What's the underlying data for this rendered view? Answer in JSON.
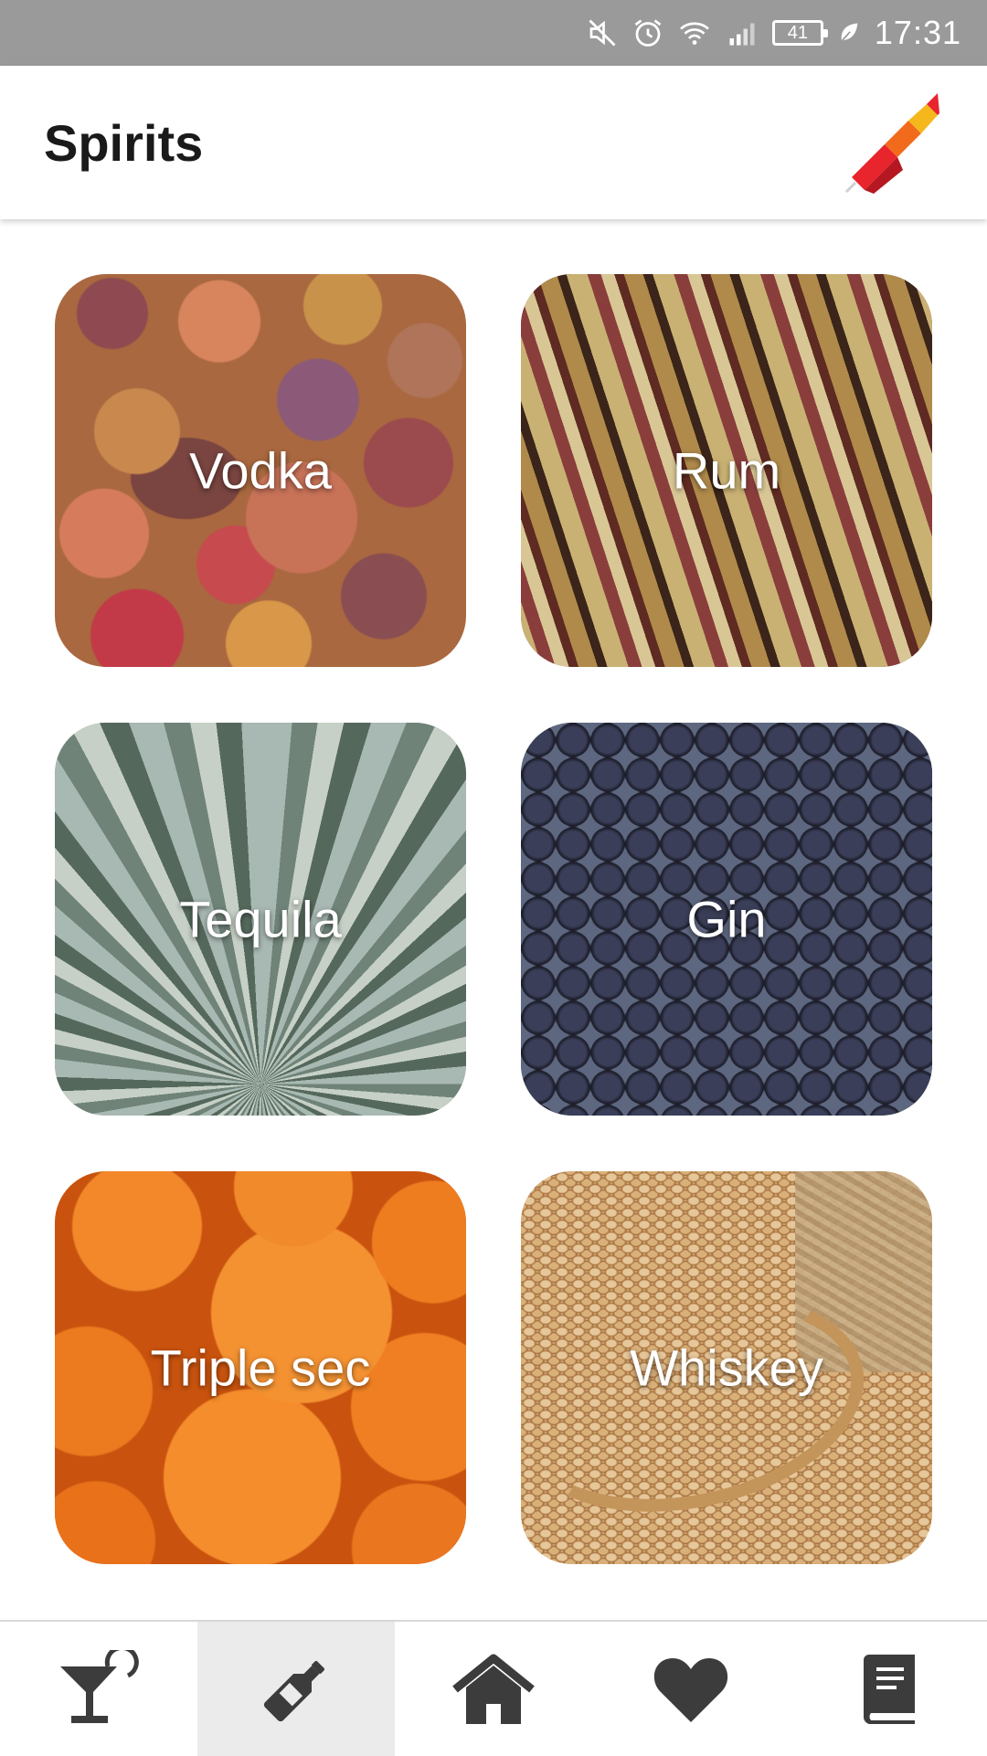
{
  "status_bar": {
    "battery": "41",
    "time": "17:31",
    "icons": [
      "mute-icon",
      "alarm-icon",
      "wifi-icon",
      "signal-icon",
      "battery-icon",
      "leaf-icon"
    ]
  },
  "app_bar": {
    "title": "Spirits",
    "logo_icon": "app-logo-icon"
  },
  "tiles": [
    {
      "label": "Vodka"
    },
    {
      "label": "Rum"
    },
    {
      "label": "Tequila"
    },
    {
      "label": "Gin"
    },
    {
      "label": "Triple sec"
    },
    {
      "label": "Whiskey"
    }
  ],
  "bottom_nav": {
    "items": [
      {
        "icon": "cocktail-glass-icon",
        "active": false
      },
      {
        "icon": "bottle-icon",
        "active": true
      },
      {
        "icon": "home-icon",
        "active": false
      },
      {
        "icon": "heart-icon",
        "active": false
      },
      {
        "icon": "book-icon",
        "active": false
      }
    ]
  },
  "colors": {
    "status_bar_bg": "#9a9a9a",
    "icon_dark": "#3c3c3c",
    "active_tab_bg": "#ebebeb",
    "logo_red": "#e8242c",
    "logo_orange": "#f26a1b",
    "logo_yellow": "#f5b81c"
  }
}
